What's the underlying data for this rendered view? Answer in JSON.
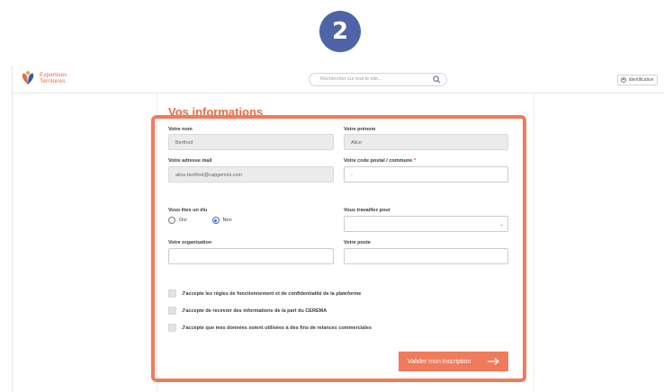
{
  "step": {
    "number": "2"
  },
  "header": {
    "logo_line1": "Expertises",
    "logo_line2": "Territoires",
    "search_placeholder": "Rechercher sur tout le site...",
    "identification_label": "Identification"
  },
  "form": {
    "title": "Vos informations",
    "last_name": {
      "label": "Votre nom",
      "value": "Berthod"
    },
    "first_name": {
      "label": "Votre prénom",
      "value": "Alice"
    },
    "email": {
      "label": "Votre adresse mail",
      "value": "alice.berthod@capgemini.com"
    },
    "postal": {
      "label": "Votre code postal / commune",
      "required_mark": "*",
      "value": "-"
    },
    "elu": {
      "label": "Vous êtes un élu",
      "options": [
        "Oui",
        "Non"
      ],
      "selected": "Non"
    },
    "works_for": {
      "label": "Vous travaillez pour",
      "value": ""
    },
    "organisation": {
      "label": "Votre organisation",
      "value": ""
    },
    "poste": {
      "label": "Votre poste",
      "value": ""
    },
    "checkboxes": [
      {
        "label": "J'accepte les règles de fonctionnement et de confidentialité de la plateforme",
        "checked": false
      },
      {
        "label": "J'accepte de recevoir des informations de la part du CEREMA",
        "checked": false
      },
      {
        "label": "J'accepte que mes données soient utilisées à des fins de relances commerciales",
        "checked": false
      }
    ],
    "submit_label": "Valider mon inscription"
  },
  "colors": {
    "accent": "#ef7b5b",
    "step_badge": "#4F63A8",
    "radio_selected": "#2f6fd6"
  }
}
